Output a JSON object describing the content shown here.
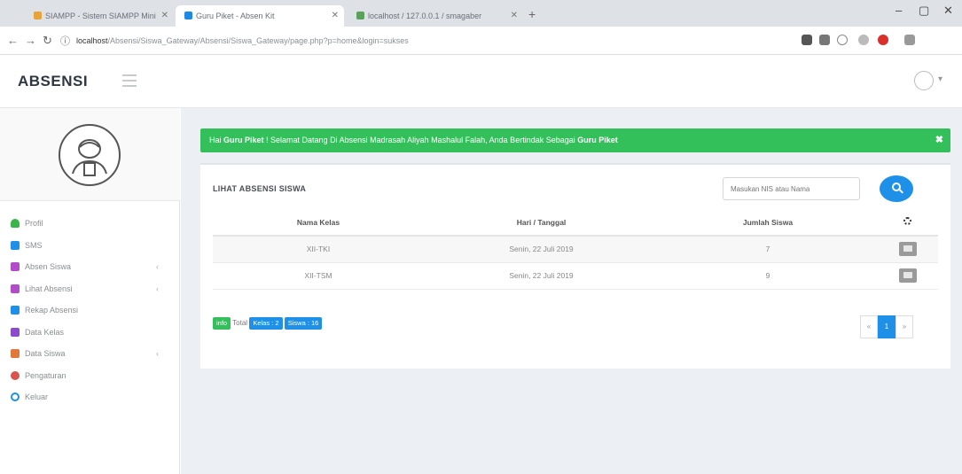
{
  "browser": {
    "tabs": [
      {
        "title": "SIAMPP - Sistem SIAMPP Mini",
        "favicon_color": "#e8a23a"
      },
      {
        "title": "Guru Piket - Absen Kit",
        "favicon_color": "#1e88e5"
      },
      {
        "title": "localhost / 127.0.0.1 / smagaber",
        "favicon_color": "#5aa25a"
      }
    ],
    "new_tab": "+",
    "url_host": "localhost",
    "url_path": "/Absensi/Siswa_Gateway/Absensi/Siswa_Gateway/page.php?p=home&login=sukses",
    "window_controls": {
      "minimize": "–",
      "maximize": "▢",
      "close": "✕"
    }
  },
  "header": {
    "brand": "ABSENSI",
    "user_caret": "▾"
  },
  "sidebar": {
    "items": [
      {
        "label": "Profil",
        "icon": "user-icon",
        "color": "#3bb54a",
        "has_children": false
      },
      {
        "label": "SMS",
        "icon": "envelope-icon",
        "color": "#1e90e8",
        "has_children": false
      },
      {
        "label": "Absen Siswa",
        "icon": "calendar-icon",
        "color": "#b24cc8",
        "has_children": true
      },
      {
        "label": "Lihat Absensi",
        "icon": "list-icon",
        "color": "#b24cc8",
        "has_children": true
      },
      {
        "label": "Rekap Absensi",
        "icon": "table-icon",
        "color": "#1e90e8",
        "has_children": false
      },
      {
        "label": "Data Kelas",
        "icon": "building-icon",
        "color": "#8a4cc8",
        "has_children": false
      },
      {
        "label": "Data Siswa",
        "icon": "users-icon",
        "color": "#e0783a",
        "has_children": true
      },
      {
        "label": "Pengaturan",
        "icon": "gear-icon",
        "color": "#d9534f",
        "has_children": false
      },
      {
        "label": "Keluar",
        "icon": "logout-icon",
        "color": "#1e90e8",
        "has_children": false
      }
    ],
    "chevron": "‹"
  },
  "alert": {
    "prefix": "Hai ",
    "name": "Guru Piket",
    "message": " ! Selamat Datang Di Absensi Madrasah Aliyah Mashalul Falah, Anda Bertindak Sebagai ",
    "role": "Guru Piket",
    "close": "✖",
    "color": "#33c05a"
  },
  "panel": {
    "title": "LIHAT ABSENSI SISWA",
    "search_placeholder": "Masukan NIS atau Nama",
    "columns": [
      "Nama Kelas",
      "Hari / Tanggal",
      "Jumlah Siswa"
    ],
    "rows": [
      {
        "kelas": "XII-TKI",
        "tanggal": "Senin, 22 Juli 2019",
        "jumlah": "7"
      },
      {
        "kelas": "XII-TSM",
        "tanggal": "Senin, 22 Juli 2019",
        "jumlah": "9"
      }
    ],
    "footer": {
      "info_badge": "info",
      "total_label": "Total",
      "kelas_badge": "Kelas : 2",
      "siswa_badge": "Siswa : 16"
    },
    "pager": {
      "prev": "«",
      "current": "1",
      "next": "»"
    }
  }
}
